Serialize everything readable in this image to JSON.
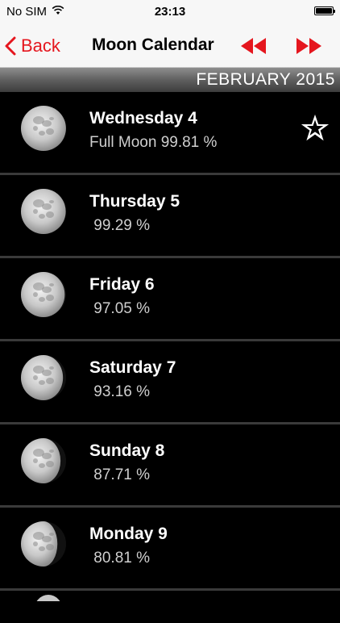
{
  "status_bar": {
    "carrier": "No SIM",
    "time": "23:13",
    "wifi_icon": "wifi-icon",
    "battery_icon": "battery-icon"
  },
  "nav": {
    "back_label": "Back",
    "title": "Moon Calendar",
    "back_icon": "chevron-left-icon",
    "prev_icon": "rewind-icon",
    "next_icon": "fast-forward-icon",
    "accent_color": "#e5161e"
  },
  "month_header": "FEBRUARY 2015",
  "days": [
    {
      "title": "Wednesday 4",
      "subtitle": "Full Moon 99.81 %",
      "illumination": 99.81,
      "starred": true
    },
    {
      "title": "Thursday 5",
      "subtitle": " 99.29 %",
      "illumination": 99.29,
      "starred": false
    },
    {
      "title": "Friday 6",
      "subtitle": " 97.05 %",
      "illumination": 97.05,
      "starred": false
    },
    {
      "title": "Saturday 7",
      "subtitle": " 93.16 %",
      "illumination": 93.16,
      "starred": false
    },
    {
      "title": "Sunday 8",
      "subtitle": " 87.71 %",
      "illumination": 87.71,
      "starred": false
    },
    {
      "title": "Monday 9",
      "subtitle": " 80.81 %",
      "illumination": 80.81,
      "starred": false
    }
  ]
}
